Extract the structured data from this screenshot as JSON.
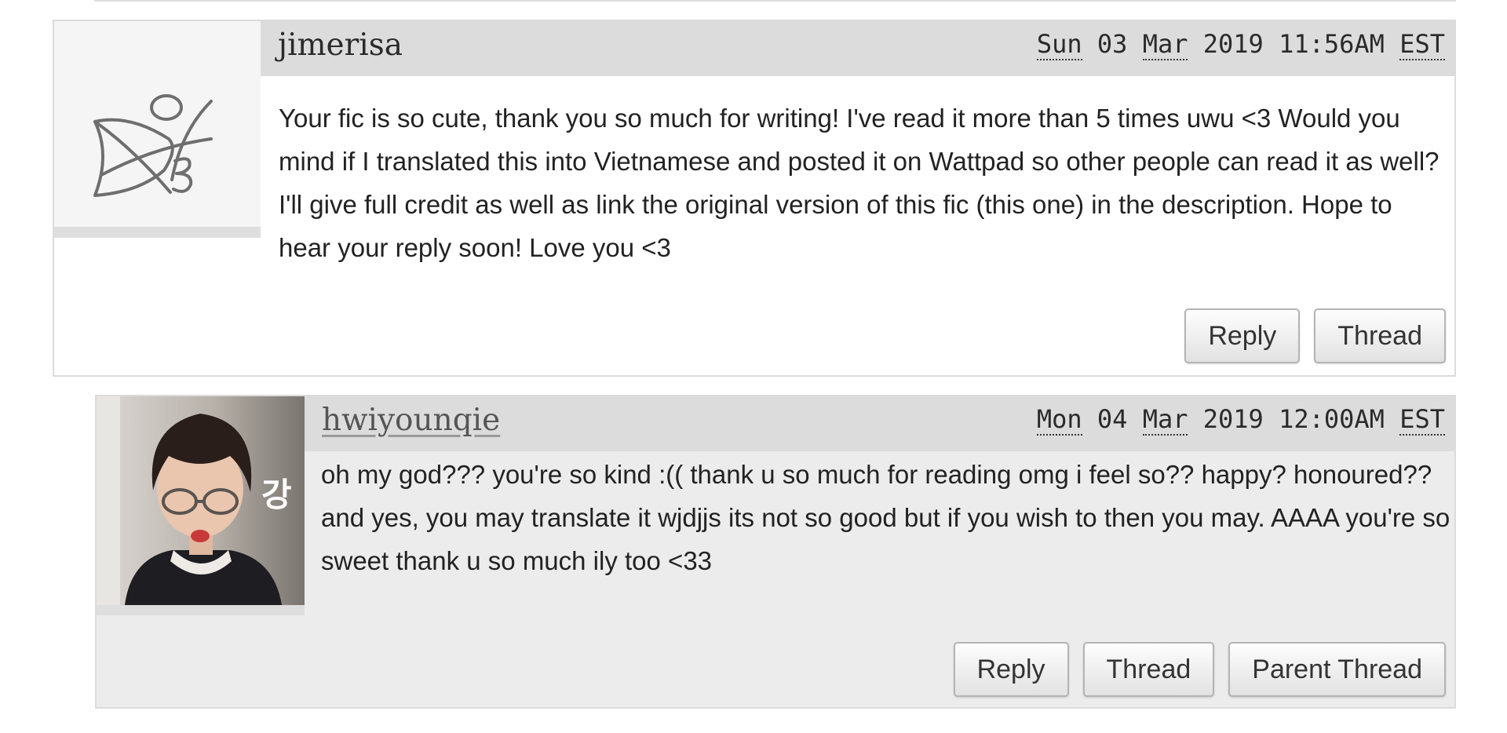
{
  "comments": [
    {
      "username": "jimerisa",
      "username_is_link": false,
      "date": {
        "weekday": "Sun",
        "day": "03",
        "month": "Mar",
        "year": "2019",
        "time": "11:56AM",
        "zone": "EST"
      },
      "body": "Your fic is so cute, thank you so much for writing! I've read it more than 5 times uwu <3 Would you mind if I translated this into Vietnamese and posted it on Wattpad so other people can read it as well? I'll give full credit as well as link the original version of this fic (this one) in the description. Hope to hear your reply soon! Love you <3",
      "buttons": {
        "reply": "Reply",
        "thread": "Thread"
      }
    },
    {
      "username": "hwiyounqie",
      "username_is_link": true,
      "date": {
        "weekday": "Mon",
        "day": "04",
        "month": "Mar",
        "year": "2019",
        "time": "12:00AM",
        "zone": "EST"
      },
      "body": "oh my god??? you're so kind :(( thank u so much for reading omg i feel so?? happy? honoured?? and yes, you may translate it wjdjjs its not so good but if you wish to then you may. AAAA you're so sweet thank u so much ily too <33",
      "avatar_caption": "강",
      "buttons": {
        "reply": "Reply",
        "thread": "Thread",
        "parent_thread": "Parent Thread"
      }
    }
  ],
  "colors": {
    "header_bar": "#dcdcdc",
    "reply_background": "#ececec",
    "border": "#dcdcdc",
    "text": "#222222"
  }
}
